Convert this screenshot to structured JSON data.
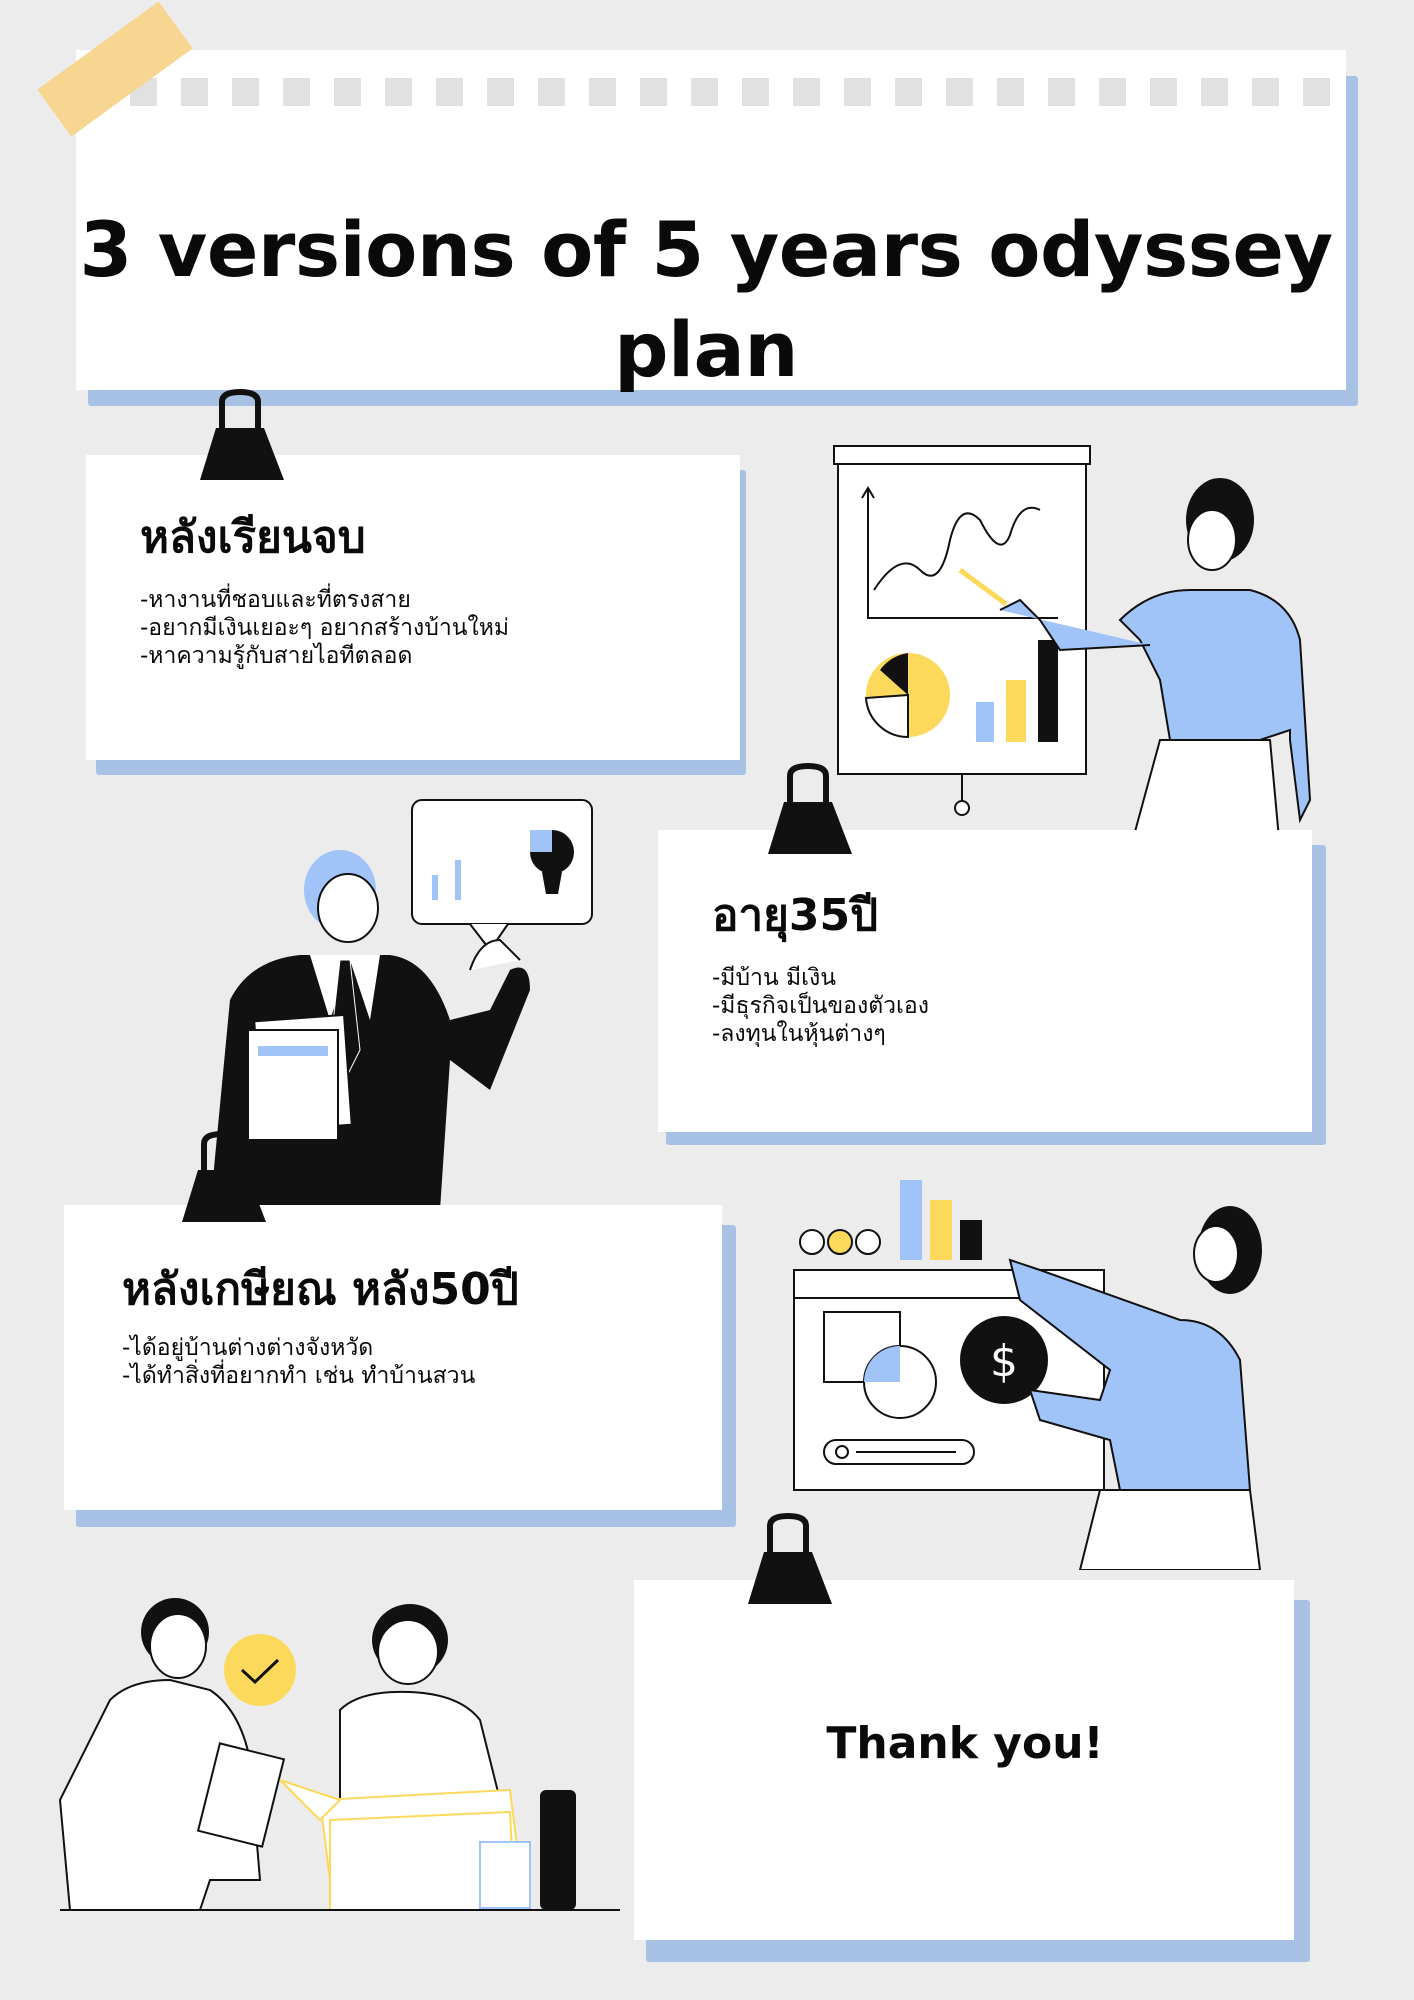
{
  "title": "3 versions of 5 years odyssey plan",
  "sections": [
    {
      "heading": "หลังเรียนจบ",
      "items": [
        "-หางานที่ชอบและที่ตรงสาย",
        "-อยากมีเงินเยอะๆ อยากสร้างบ้านใหม่",
        "-หาความรู้กับสายไอทีตลอด"
      ]
    },
    {
      "heading": "อายุ35ปี",
      "items": [
        "-มีบ้าน มีเงิน",
        "-มีธุรกิจเป็นของตัวเอง",
        "-ลงทุนในหุ้นต่างๆ"
      ]
    },
    {
      "heading": "หลังเกษียณ หลัง50ปี",
      "items": [
        "-ได้อยู่บ้านต่างต่างจังหวัด",
        "-ได้ทำสิ่งที่อยากทำ เช่น ทำบ้านสวน"
      ]
    }
  ],
  "closing": "Thank you!",
  "icon_glyph": "$",
  "colors": {
    "background": "#ececec",
    "accent_blue": "#a0c4f8",
    "accent_yellow": "#fcd95a",
    "tape": "#f6d690",
    "card_shadow": "#a8c2e6"
  }
}
